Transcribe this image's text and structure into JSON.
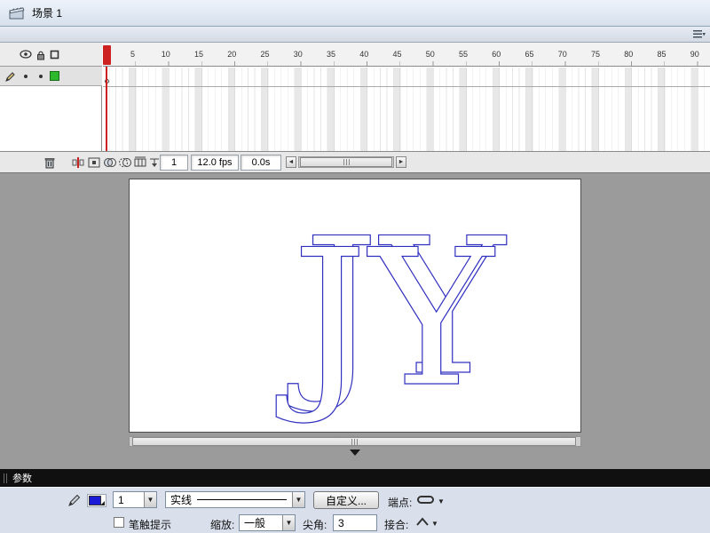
{
  "scene_bar": {
    "scene_label": "场景 1"
  },
  "timeline": {
    "ruler_ticks": [
      "5",
      "10",
      "15",
      "20",
      "25",
      "30",
      "35",
      "40",
      "45",
      "50",
      "55",
      "60",
      "65",
      "70",
      "75",
      "80",
      "85",
      "90"
    ],
    "status": {
      "current_frame": "1",
      "frame_rate": "12.0 fps",
      "elapsed_time": "0.0s"
    }
  },
  "stage": {
    "artwork_text": "JY",
    "outline_color": "#3030c0"
  },
  "panel": {
    "tab_label": "参数"
  },
  "properties": {
    "stroke_width": "1",
    "stroke_style": "实线",
    "custom_button_label": "自定义...",
    "cap_label": "端点:",
    "stroke_hint_label": "笔触提示",
    "scale_label": "缩放:",
    "scale_value": "一般",
    "miter_label": "尖角:",
    "miter_value": "3",
    "join_label": "接合:"
  },
  "colors": {
    "stroke_swatch": "#1a1ad6",
    "layer_outline_swatch": "#2eb82e",
    "playhead": "#cc2222"
  }
}
